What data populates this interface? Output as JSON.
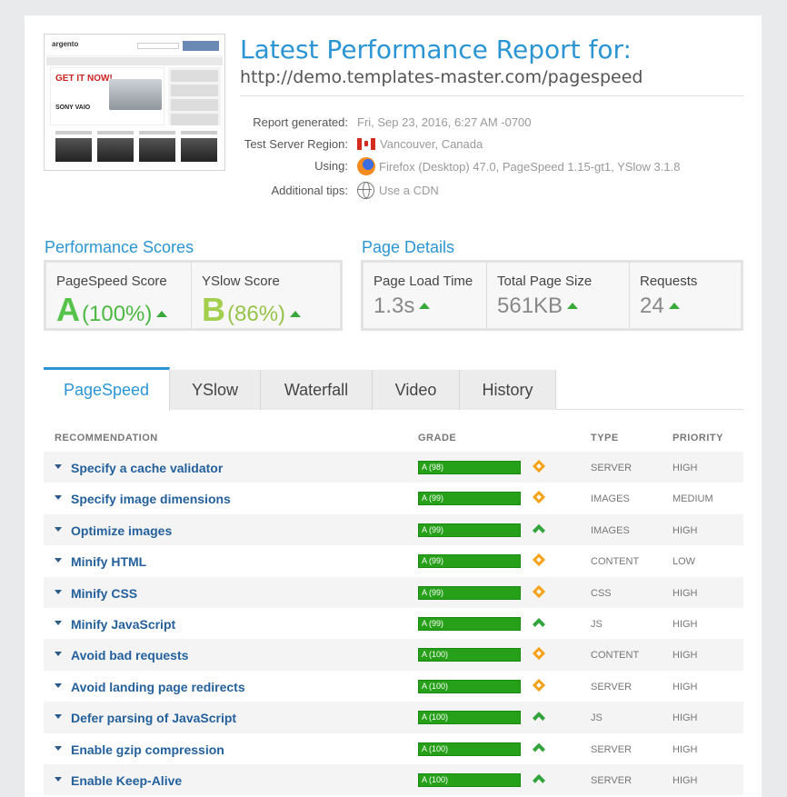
{
  "header": {
    "title": "Latest Performance Report for:",
    "url": "http://demo.templates-master.com/pagespeed"
  },
  "thumbnail": {
    "logo_text": "argento",
    "banner_text": "GET IT NOW!",
    "brand_text": "SONY VAIO"
  },
  "meta": [
    {
      "label": "Report generated:",
      "value": "Fri, Sep 23, 2016, 6:27 AM -0700",
      "icon": ""
    },
    {
      "label": "Test Server Region:",
      "value": "Vancouver, Canada",
      "icon": "canada-flag-icon"
    },
    {
      "label": "Using:",
      "value": "Firefox (Desktop) 47.0, PageSpeed 1.15-gt1, YSlow 3.1.8",
      "icon": "firefox-icon"
    },
    {
      "label": "Additional tips:",
      "value": "Use a CDN",
      "icon": "globe-icon"
    }
  ],
  "scores": {
    "title": "Performance Scores",
    "pagespeed": {
      "label": "PageSpeed Score",
      "grade": "A",
      "percent": "(100%)"
    },
    "yslow": {
      "label": "YSlow Score",
      "grade": "B",
      "percent": "(86%)"
    }
  },
  "details": {
    "title": "Page Details",
    "load_time": {
      "label": "Page Load Time",
      "value": "1.3s"
    },
    "page_size": {
      "label": "Total Page Size",
      "value": "561KB"
    },
    "requests": {
      "label": "Requests",
      "value": "24"
    }
  },
  "tabs": [
    "PageSpeed",
    "YSlow",
    "Waterfall",
    "Video",
    "History"
  ],
  "table": {
    "headers": {
      "recommendation": "RECOMMENDATION",
      "grade": "GRADE",
      "type": "TYPE",
      "priority": "PRIORITY"
    },
    "rows": [
      {
        "name": "Specify a cache validator",
        "grade": "A (98)",
        "score": 98,
        "indicator": "diamond",
        "type": "SERVER",
        "priority": "HIGH"
      },
      {
        "name": "Specify image dimensions",
        "grade": "A (99)",
        "score": 99,
        "indicator": "diamond",
        "type": "IMAGES",
        "priority": "MEDIUM"
      },
      {
        "name": "Optimize images",
        "grade": "A (99)",
        "score": 99,
        "indicator": "up",
        "type": "IMAGES",
        "priority": "HIGH"
      },
      {
        "name": "Minify HTML",
        "grade": "A (99)",
        "score": 99,
        "indicator": "diamond",
        "type": "CONTENT",
        "priority": "LOW"
      },
      {
        "name": "Minify CSS",
        "grade": "A (99)",
        "score": 99,
        "indicator": "diamond",
        "type": "CSS",
        "priority": "HIGH"
      },
      {
        "name": "Minify JavaScript",
        "grade": "A (99)",
        "score": 99,
        "indicator": "up",
        "type": "JS",
        "priority": "HIGH"
      },
      {
        "name": "Avoid bad requests",
        "grade": "A (100)",
        "score": 100,
        "indicator": "diamond",
        "type": "CONTENT",
        "priority": "HIGH"
      },
      {
        "name": "Avoid landing page redirects",
        "grade": "A (100)",
        "score": 100,
        "indicator": "diamond",
        "type": "SERVER",
        "priority": "HIGH"
      },
      {
        "name": "Defer parsing of JavaScript",
        "grade": "A (100)",
        "score": 100,
        "indicator": "up",
        "type": "JS",
        "priority": "HIGH"
      },
      {
        "name": "Enable gzip compression",
        "grade": "A (100)",
        "score": 100,
        "indicator": "up",
        "type": "SERVER",
        "priority": "HIGH"
      },
      {
        "name": "Enable Keep-Alive",
        "grade": "A (100)",
        "score": 100,
        "indicator": "up",
        "type": "SERVER",
        "priority": "HIGH"
      }
    ]
  }
}
